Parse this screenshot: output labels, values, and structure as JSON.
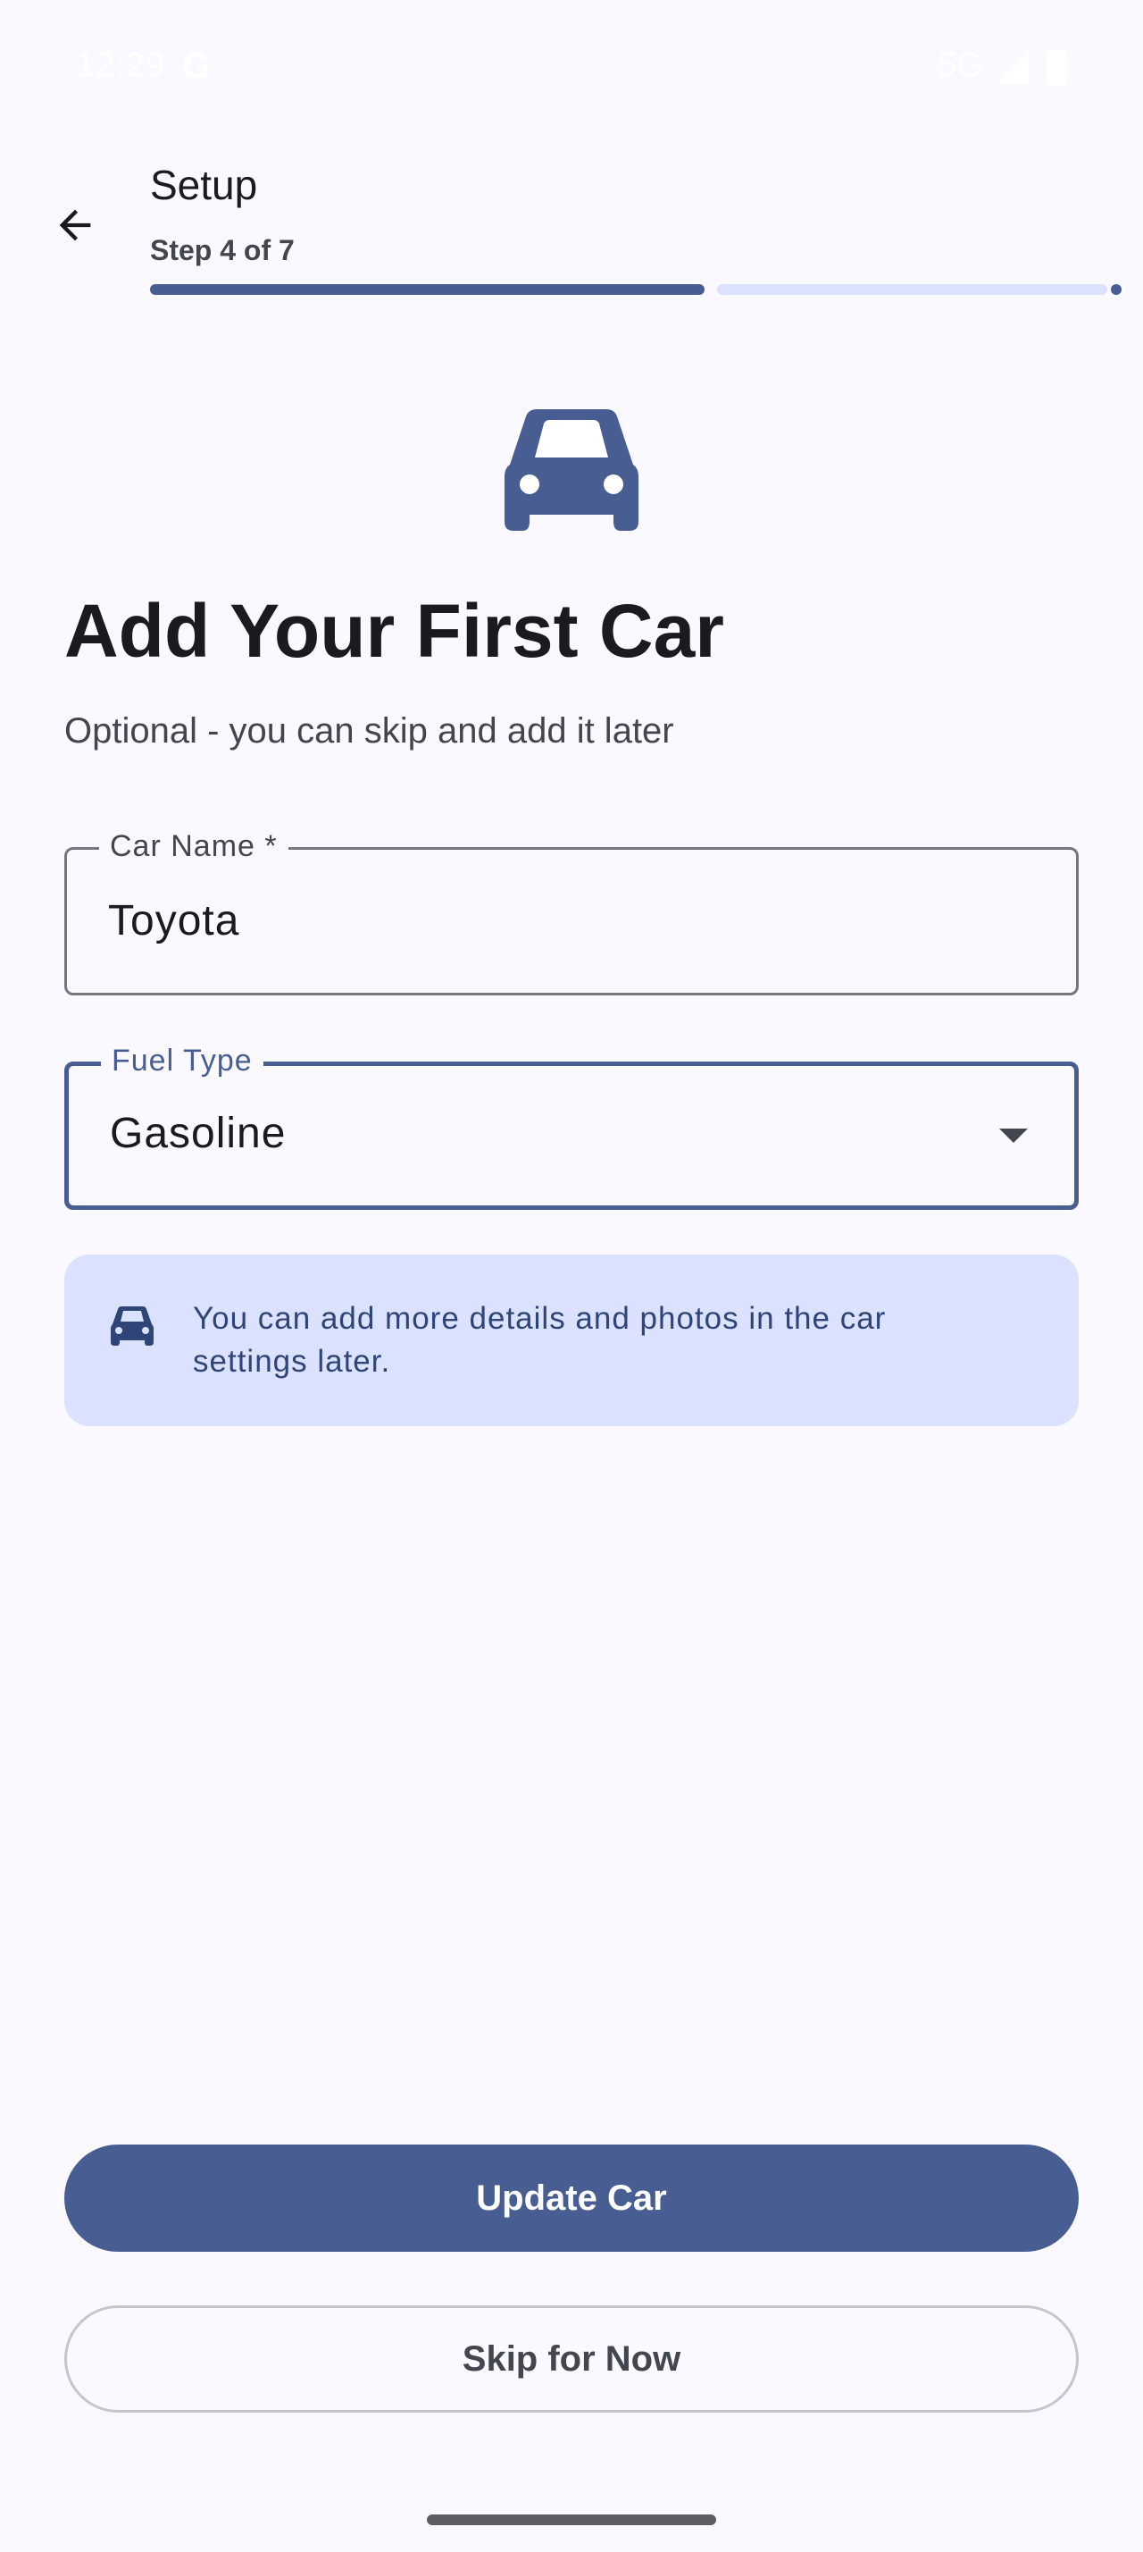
{
  "status_bar": {
    "time": "12:29",
    "g_logo": "G",
    "network": "5G",
    "signal_icon": "cell-signal-icon",
    "battery_icon": "battery-icon"
  },
  "app_bar": {
    "back_icon": "arrow-back-icon",
    "title": "Setup",
    "step": "Step 4 of 7",
    "progress": {
      "current": 4,
      "total": 7,
      "fraction": 0.571
    }
  },
  "hero": {
    "icon": "car-icon",
    "headline": "Add Your First Car",
    "subtitle": "Optional - you can skip and add it later"
  },
  "form": {
    "car_name": {
      "label": "Car Name *",
      "value": "Toyota"
    },
    "fuel_type": {
      "label": "Fuel Type",
      "value": "Gasoline"
    }
  },
  "info_card": {
    "icon": "car-icon",
    "text": "You can add more details and photos in the car settings later."
  },
  "actions": {
    "primary": "Update Car",
    "secondary": "Skip for Now"
  },
  "colors": {
    "primary": "#485D92",
    "primary_container": "#DAE2FF",
    "background": "#F9F9FF",
    "on_surface": "#1A1B21",
    "on_surface_variant": "#44464F",
    "outline": "#757780"
  }
}
